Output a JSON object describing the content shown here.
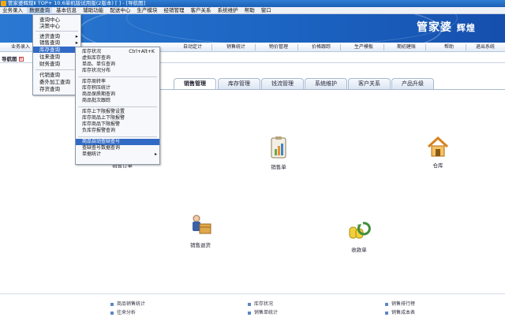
{
  "window": {
    "title": "管家婆辉煌Ⅱ TOP+ 10.6单机版试用版(2版本) [ ] - [导航图]"
  },
  "menubar": [
    "业务录入",
    "数据查询",
    "基本信息",
    "辅助功能",
    "配送中心",
    "生产模块",
    "经销管理",
    "客户关系",
    "系统维护",
    "帮助",
    "窗口"
  ],
  "brand": {
    "name": "管家婆",
    "tail": "辉煌"
  },
  "navrow": [
    "业务录入",
    "自动定计",
    "销售统计",
    "物价管理",
    "价格跟踪",
    "生产模板",
    "期初建账",
    "帮助",
    "退出系统"
  ],
  "navigator_label": "导航图",
  "query_menu": {
    "items": [
      "查询中心",
      "决策中心",
      "进货查询",
      "销售查询",
      "库存查询",
      "往来查询",
      "财务查询",
      "代销查询",
      "委外加工查询",
      "存货查询"
    ]
  },
  "stock_menu": {
    "items": [
      {
        "label": "库存状况",
        "shortcut": "Ctrl+Alt+K"
      },
      {
        "label": "虚拟库存查询"
      },
      {
        "label": "单品、单位查询"
      },
      {
        "label": "库存状况分布"
      },
      {
        "label": "库存周转率"
      },
      {
        "label": "库存积压统计"
      },
      {
        "label": "商品保质期查询"
      },
      {
        "label": "商品批次跟踪"
      },
      {
        "label": "库存上下限报警设置"
      },
      {
        "label": "库存商品上下限报警"
      },
      {
        "label": "库存商品下限报警"
      },
      {
        "label": "负库存报警查询"
      },
      {
        "label": "商品自动查缺查号"
      },
      {
        "label": "查缺查号数据查询"
      },
      {
        "label": "单据统计"
      }
    ]
  },
  "tabs": [
    "销售管理",
    "库存管理",
    "钱流管理",
    "系统维护",
    "客户关系",
    "产品升级"
  ],
  "panel_items": [
    "销售订单",
    "销售单",
    "仓库",
    "销售退货",
    "收款单"
  ],
  "bottom_links": [
    "商品销售统计",
    "往来分析",
    "库存状况",
    "销售单统计",
    "销售排行榜",
    "销售成本表"
  ],
  "colors": {
    "titlebar": "#1a5fb5",
    "banner": "#1b63c0",
    "menu_highlight": "#316ac5"
  }
}
